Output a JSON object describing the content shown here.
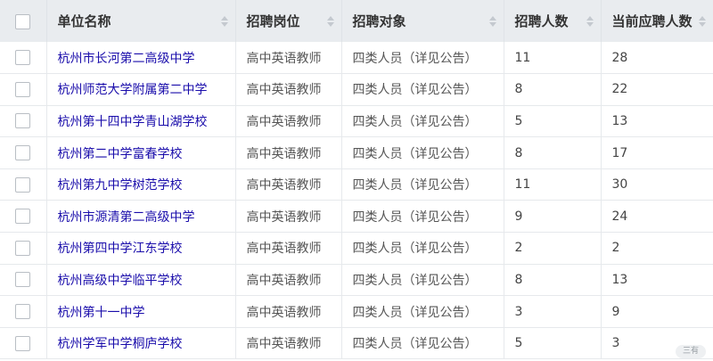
{
  "table": {
    "headers": {
      "name": "单位名称",
      "post": "招聘岗位",
      "target": "招聘对象",
      "count": "招聘人数",
      "current": "当前应聘人数"
    },
    "rows": [
      {
        "name": "杭州市长河第二高级中学",
        "post": "高中英语教师",
        "target": "四类人员（详见公告）",
        "count": "11",
        "current": "28"
      },
      {
        "name": "杭州师范大学附属第二中学",
        "post": "高中英语教师",
        "target": "四类人员（详见公告）",
        "count": "8",
        "current": "22"
      },
      {
        "name": "杭州第十四中学青山湖学校",
        "post": "高中英语教师",
        "target": "四类人员（详见公告）",
        "count": "5",
        "current": "13"
      },
      {
        "name": "杭州第二中学富春学校",
        "post": "高中英语教师",
        "target": "四类人员（详见公告）",
        "count": "8",
        "current": "17"
      },
      {
        "name": "杭州第九中学树范学校",
        "post": "高中英语教师",
        "target": "四类人员（详见公告）",
        "count": "11",
        "current": "30"
      },
      {
        "name": "杭州市源清第二高级中学",
        "post": "高中英语教师",
        "target": "四类人员（详见公告）",
        "count": "9",
        "current": "24"
      },
      {
        "name": "杭州第四中学江东学校",
        "post": "高中英语教师",
        "target": "四类人员（详见公告）",
        "count": "2",
        "current": "2"
      },
      {
        "name": "杭州高级中学临平学校",
        "post": "高中英语教师",
        "target": "四类人员（详见公告）",
        "count": "8",
        "current": "13"
      },
      {
        "name": "杭州第十一中学",
        "post": "高中英语教师",
        "target": "四类人员（详见公告）",
        "count": "3",
        "current": "9"
      },
      {
        "name": "杭州学军中学桐庐学校",
        "post": "高中英语教师",
        "target": "四类人员（详见公告）",
        "count": "5",
        "current": "3"
      }
    ]
  },
  "float_button": {
    "label": "三有"
  }
}
